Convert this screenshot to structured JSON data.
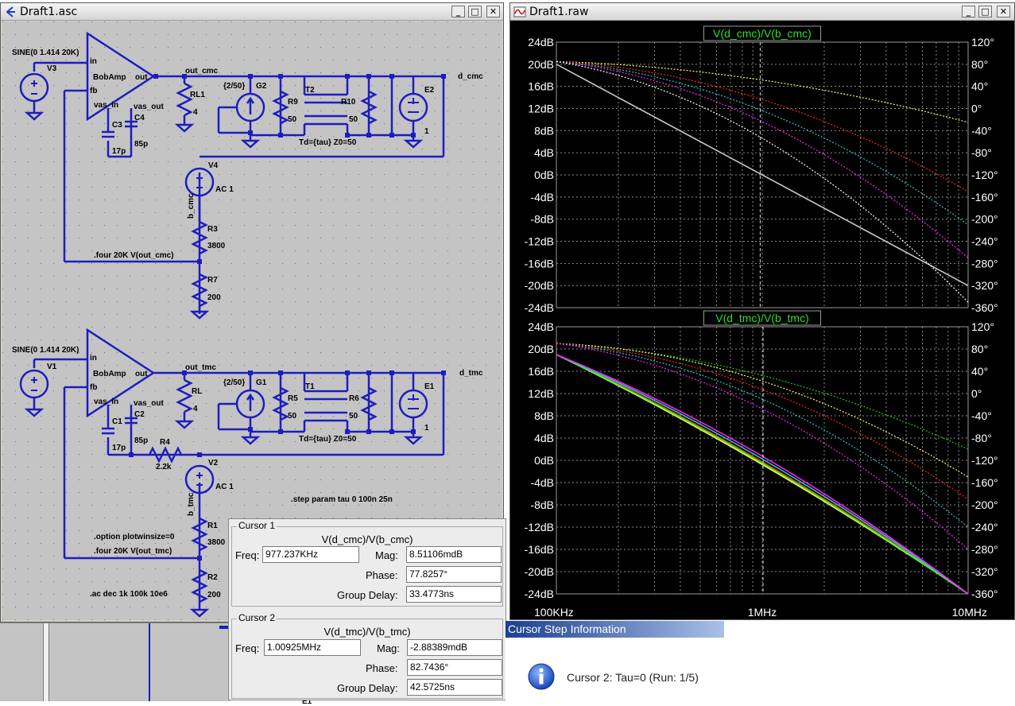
{
  "schematic_window": {
    "title": "Draft1.asc",
    "labels": {
      "sine_top": "SINE(0 1.414 20K)",
      "v3": "V3",
      "in_top": "in",
      "bobamp_top": "BobAmp",
      "out_top": "out",
      "fb_top": "fb",
      "vasin_top": "vas_in",
      "vasout_top": "vas_out",
      "c3": "C3",
      "c4": "C4",
      "c3_val": "17p",
      "c4_val": "85p",
      "out_cmc": "out_cmc",
      "rl1": "RL1",
      "rl1_val": "4",
      "g2_gain": "{2/50}",
      "g2": "G2",
      "r9": "R9",
      "r9_val": "50",
      "t2": "T2",
      "r10": "R10",
      "r10_val": "50",
      "e2": "E2",
      "e2_val": "1",
      "d_cmc": "d_cmc",
      "td_top": "Td={tau} Z0=50",
      "v4": "V4",
      "ac_top": "AC 1",
      "b_cmc": "b_cmc",
      "r3": "R3",
      "r3_val": "3800",
      "four_cmc": ".four 20K  V(out_cmc)",
      "r7": "R7",
      "r7_val": "200",
      "sine_bot": "SINE(0 1.414 20K)",
      "v1": "V1",
      "in_bot": "in",
      "bobamp_bot": "BobAmp",
      "out_bot": "out",
      "fb_bot": "fb",
      "vasin_bot": "vas_in",
      "vasout_bot": "vas_out",
      "c1": "C1",
      "c2": "C2",
      "c1_val": "17p",
      "c2_val": "85p",
      "r4": "R4",
      "r4_val": "2.2k",
      "out_tmc": "out_tmc",
      "rl": "RL",
      "rl_val": "4",
      "g1_gain": "{2/50}",
      "g1": "G1",
      "r5": "R5",
      "r5_val": "50",
      "t1": "T1",
      "r6": "R6",
      "r6_val": "50",
      "e1": "E1",
      "e1_val": "1",
      "d_tmc": "d_tmc",
      "td_bot": "Td={tau} Z0=50",
      "v2": "V2",
      "ac_bot": "AC 1",
      "b_tmc": "b_tmc",
      "step": ".step param tau 0 100n 25n",
      "r1": "R1",
      "r1_val": "3800",
      "option": ".option plotwinsize=0",
      "four_tmc": ".four 20K  V(out_tmc)",
      "r2": "R2",
      "r2_val": "200",
      "ac_cmd": ".ac dec 1k 100k 10e6",
      "e1_partial": "E1"
    }
  },
  "plot_window": {
    "title": "Draft1.raw",
    "x_ticks": [
      "100KHz",
      "1MHz",
      "10MHz"
    ],
    "y_ticks_db": [
      "24dB",
      "20dB",
      "16dB",
      "12dB",
      "8dB",
      "4dB",
      "0dB",
      "-4dB",
      "-8dB",
      "-12dB",
      "-16dB",
      "-20dB",
      "-24dB"
    ],
    "y_ticks_phase": [
      "120°",
      "80°",
      "40°",
      "0°",
      "-40°",
      "-80°",
      "-120°",
      "-160°",
      "-200°",
      "-240°",
      "-280°",
      "-320°",
      "-360°"
    ]
  },
  "chart_data": [
    {
      "type": "line",
      "title": "V(d_cmc)/V(b_cmc)",
      "x_scale": "log",
      "xlim": [
        100000,
        10000000
      ],
      "ylim_left": [
        -24,
        24
      ],
      "ylim_right": [
        -360,
        120
      ],
      "grid": true,
      "x": [
        100000,
        1000000,
        10000000
      ],
      "series": [
        {
          "values": [
            20,
            0,
            -20
          ],
          "color": "#c8c8c8",
          "style": "solid"
        },
        {
          "values": [
            20.5,
            19.3,
            9.5
          ],
          "color": "#ffff40",
          "style": "dotted"
        },
        {
          "values": [
            20.5,
            18.5,
            -3
          ],
          "color": "#ff2020",
          "style": "dotted"
        },
        {
          "values": [
            20.5,
            17.5,
            -9
          ],
          "color": "#20c8c8",
          "style": "dotted"
        },
        {
          "values": [
            20.5,
            16.5,
            -15
          ],
          "color": "#ff20ff",
          "style": "dotted"
        },
        {
          "values": [
            20.5,
            14.5,
            -23
          ],
          "color": "#ffffff",
          "style": "dotted"
        }
      ]
    },
    {
      "type": "line",
      "title": "V(d_tmc)/V(b_tmc)",
      "x_scale": "log",
      "xlim": [
        100000,
        10000000
      ],
      "ylim_left": [
        -24,
        24
      ],
      "ylim_right": [
        -360,
        120
      ],
      "grid": true,
      "x": [
        100000,
        1000000,
        10000000
      ],
      "series": [
        {
          "values": [
            19,
            1,
            -24
          ],
          "color": "#ffff40",
          "style": "solid"
        },
        {
          "values": [
            19,
            2,
            -24
          ],
          "color": "#ff2020",
          "style": "solid"
        },
        {
          "values": [
            19,
            1.5,
            -24
          ],
          "color": "#20ff20",
          "style": "solid"
        },
        {
          "values": [
            19,
            3,
            -24
          ],
          "color": "#20c8c8",
          "style": "solid"
        },
        {
          "values": [
            19,
            4,
            -24
          ],
          "color": "#ff20ff",
          "style": "solid"
        },
        {
          "values": [
            21,
            19,
            2
          ],
          "color": "#20c020",
          "style": "dotted"
        },
        {
          "values": [
            21,
            19.5,
            -3
          ],
          "color": "#ffff40",
          "style": "dotted"
        },
        {
          "values": [
            21,
            18.5,
            -7
          ],
          "color": "#ff2020",
          "style": "dotted"
        },
        {
          "values": [
            21,
            17.5,
            -12
          ],
          "color": "#20c8c8",
          "style": "dotted"
        },
        {
          "values": [
            21,
            16,
            -16
          ],
          "color": "#ff20ff",
          "style": "dotted"
        }
      ]
    }
  ],
  "cursor1": {
    "legend": "Cursor 1",
    "expr": "V(d_cmc)/V(b_cmc)",
    "freq_label": "Freq:",
    "freq": "977.237KHz",
    "mag_label": "Mag:",
    "mag": "8.51106mdB",
    "phase_label": "Phase:",
    "phase": "77.8257°",
    "gd_label": "Group Delay:",
    "gd": "33.4773ns"
  },
  "cursor2": {
    "legend": "Cursor 2",
    "expr": "V(d_tmc)/V(b_tmc)",
    "freq_label": "Freq:",
    "freq": "1.00925MHz",
    "mag_label": "Mag:",
    "mag": "-2.88389mdB",
    "phase_label": "Phase:",
    "phase": "82.7436°",
    "gd_label": "Group Delay:",
    "gd": "42.5725ns"
  },
  "step_info": {
    "title": "Cursor Step Information",
    "message": "Cursor 2: Tau=0  (Run: 1/5)"
  }
}
